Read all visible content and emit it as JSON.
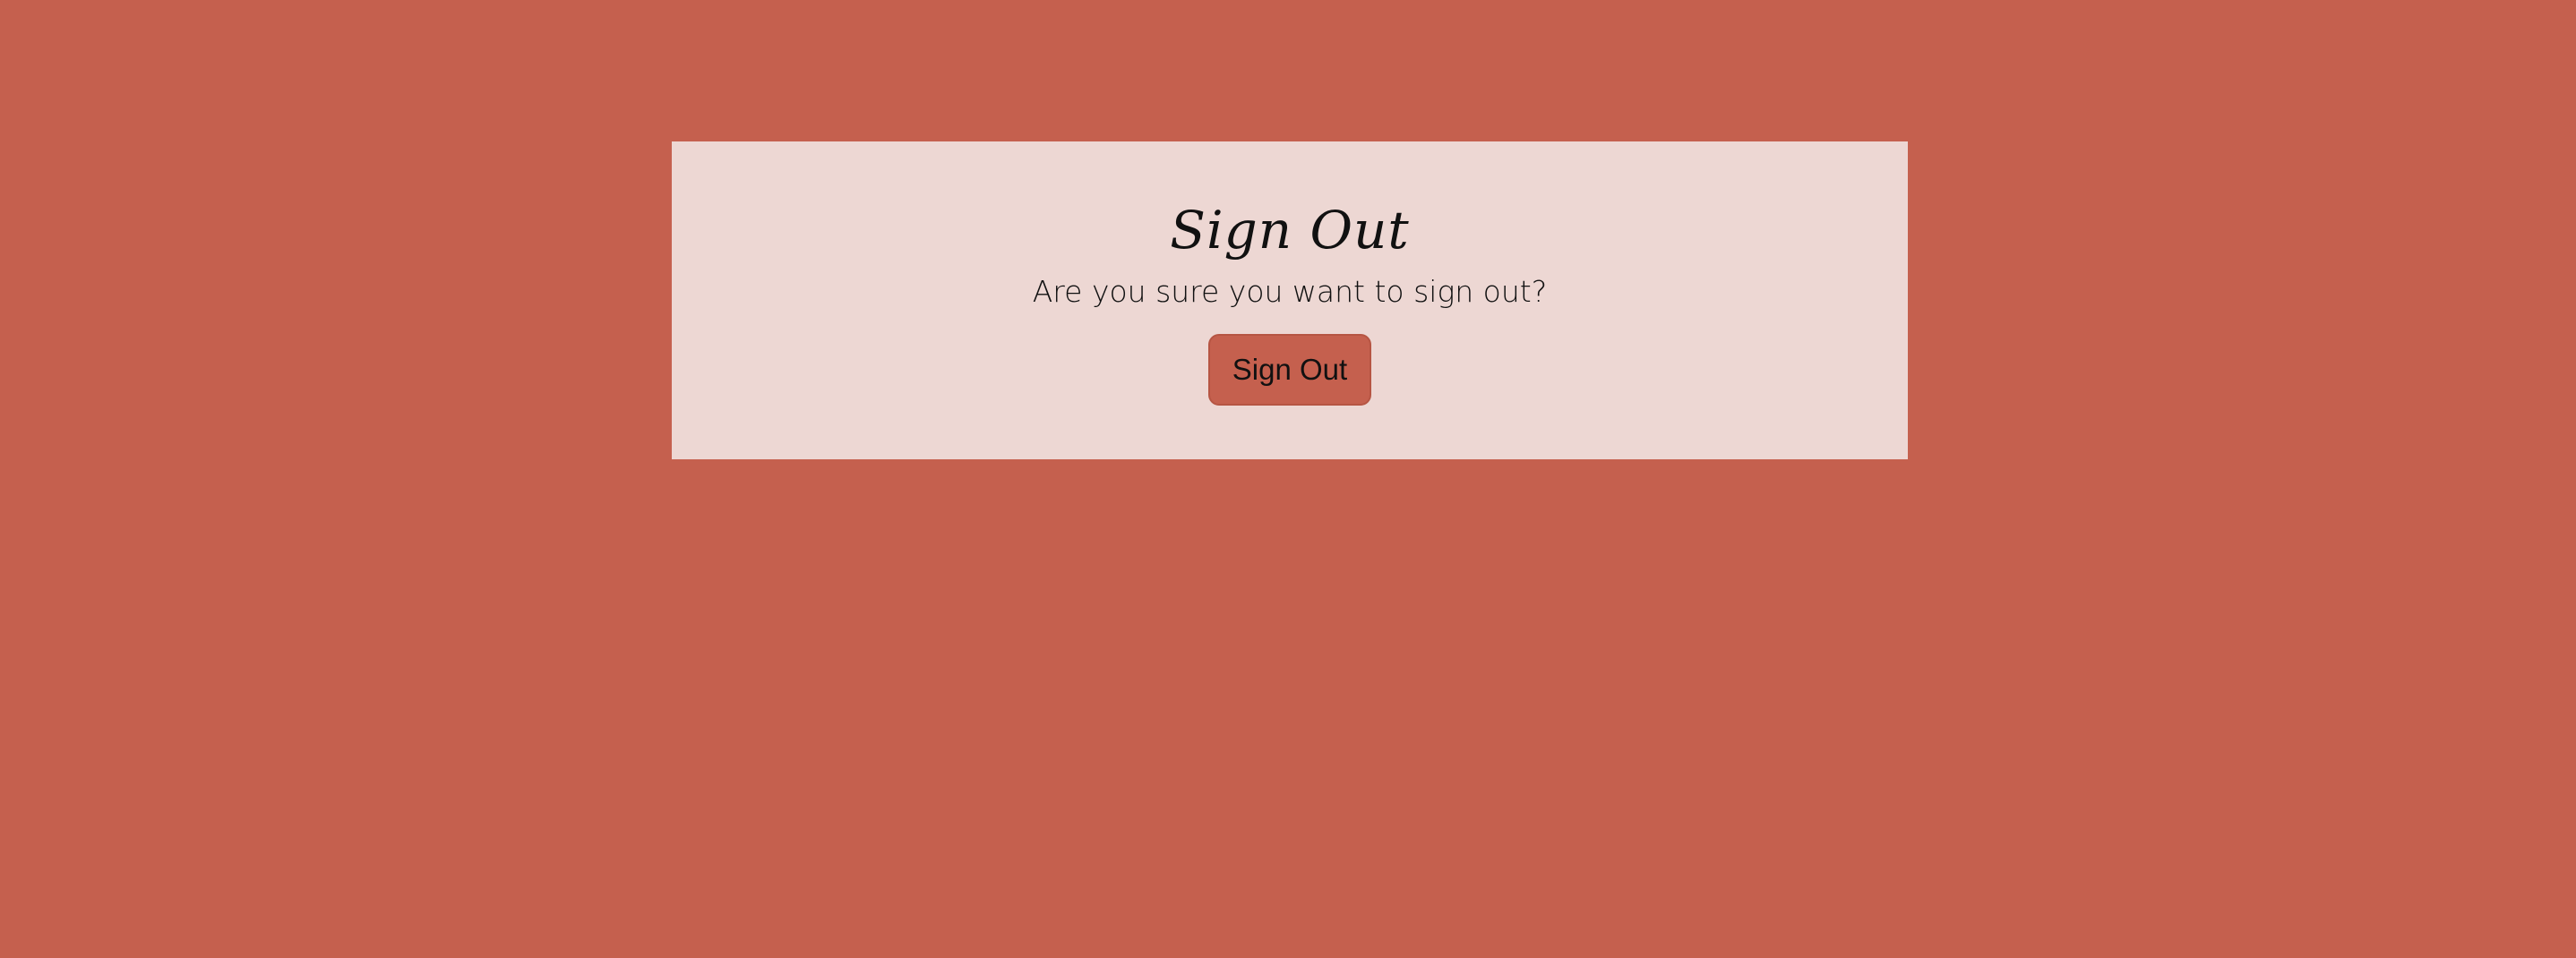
{
  "dialog": {
    "title": "Sign Out",
    "message": "Are you sure you want to sign out?",
    "confirm_label": "Sign Out"
  },
  "colors": {
    "page_background": "#c5604e",
    "card_background": "#edd7d3",
    "button_background": "#c5604e",
    "text": "#111111"
  }
}
